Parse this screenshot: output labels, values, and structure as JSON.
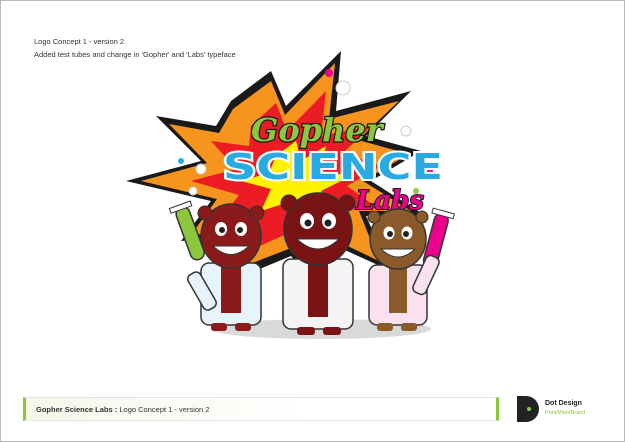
{
  "notes": {
    "line1": "Logo Concept 1 - version 2",
    "line2": "Added test tubes and change in 'Gopher' and 'Labs' typeface"
  },
  "logo": {
    "word1": "Gopher",
    "word2": "SCIENCE",
    "word3": "Labs",
    "colors": {
      "burst_outer": "#1a1a1a",
      "burst_orange": "#f7941d",
      "burst_red": "#ed1c24",
      "burst_yellow": "#fff200",
      "gopher_green": "#8dc63f",
      "science_blue": "#29abe2",
      "labs_pink": "#ec008c"
    }
  },
  "footer": {
    "title": "Gopher Science Labs :",
    "subtitle": " Logo Concept 1  - version 2"
  },
  "brand": {
    "name": "Dot Design",
    "tagline": "Print/Web/Brand",
    "accent": "#8cc63f"
  }
}
